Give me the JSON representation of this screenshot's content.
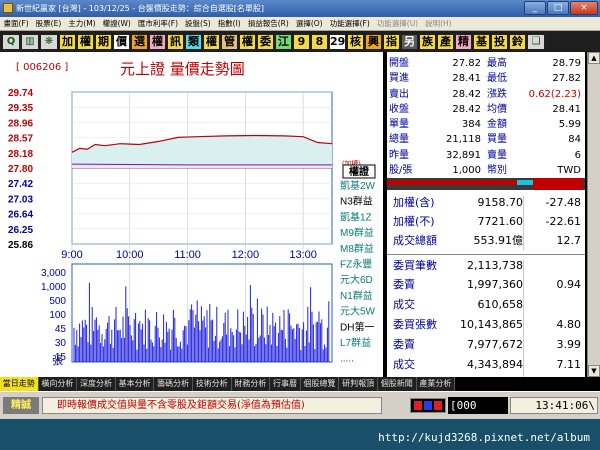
{
  "window": {
    "title": "新世紀贏家 [台灣] - 103/12/25 - 台盤價股走勢：綜合自選股[名單股]",
    "min": "_",
    "max": "□",
    "close": "×"
  },
  "menu": [
    "畫面(F)",
    "股票(E)",
    "主力(M)",
    "權證(W)",
    "匯市利率(F)",
    "設盤(S)",
    "指數(I)",
    "損益報告(R)",
    "選擇(O)",
    "功能選擇(F)",
    "功能選擇(U)",
    "說明(H)"
  ],
  "toolbar": [
    {
      "label": "Q",
      "name": "toolbar-search-icon",
      "style": "ic"
    },
    {
      "label": "▥",
      "name": "toolbar-chart-icon",
      "style": "ic"
    },
    {
      "label": "❋",
      "name": "toolbar-settings-icon",
      "style": "ic"
    },
    {
      "label": "加",
      "style": "yellow"
    },
    {
      "label": "權",
      "style": "yellow"
    },
    {
      "label": "期",
      "style": "yellow"
    },
    {
      "label": "價",
      "style": "white"
    },
    {
      "label": "選",
      "style": "orange"
    },
    {
      "label": "權",
      "style": "pink"
    },
    {
      "label": "訊",
      "style": "yellow"
    },
    {
      "label": "類",
      "style": "cyan"
    },
    {
      "label": "權",
      "style": "yellow"
    },
    {
      "label": "管",
      "style": "tan"
    },
    {
      "label": "權",
      "style": "yellow"
    },
    {
      "label": "委",
      "style": "yellow"
    },
    {
      "label": "江",
      "style": "green"
    },
    {
      "label": "9",
      "style": "yellow"
    },
    {
      "label": "8",
      "style": "yellow"
    },
    {
      "label": "29",
      "style": "white"
    },
    {
      "label": "核",
      "style": "yellow"
    },
    {
      "label": "興",
      "style": "orange"
    },
    {
      "label": "指",
      "style": "yellow"
    },
    {
      "label": "另",
      "style": "dark"
    },
    {
      "label": "族",
      "style": "yellow"
    },
    {
      "label": "產",
      "style": "yellow"
    },
    {
      "label": "精",
      "style": "pink"
    },
    {
      "label": "基",
      "style": "yellow"
    },
    {
      "label": "投",
      "style": "yellow"
    },
    {
      "label": "鈴",
      "style": "yellow"
    },
    {
      "label": "❑",
      "name": "toolbar-window-icon",
      "style": "ic"
    }
  ],
  "chart": {
    "stock_code": "[ 006206 ]",
    "title": "元上證  量價走勢圖",
    "add_weight": "(加權)",
    "warrant_header": "權證",
    "warrants": [
      "凱基2W",
      "N3群益",
      "凱基1Z",
      "M9群益",
      "M8群益",
      "FZ永豐",
      "元大6D",
      "N1群益",
      "元大5W",
      "DH第一",
      "L7群益",
      "....."
    ]
  },
  "chart_data": {
    "type": "line",
    "price_ticks": [
      "29.74",
      "29.35",
      "28.96",
      "28.57",
      "28.18",
      "27.80",
      "27.42",
      "27.03",
      "26.64",
      "26.25",
      "25.86"
    ],
    "volume_ticks": [
      "3,000",
      "1,000",
      "500",
      "100",
      "45",
      "30",
      "15"
    ],
    "volume_unit": "張",
    "x_ticks": [
      "9:00",
      "10:00",
      "11:00",
      "12:00",
      "13:00"
    ],
    "reference_price": 27.8,
    "ylim": [
      25.86,
      29.74
    ],
    "price": [
      {
        "t": 0,
        "v": 28.2
      },
      {
        "t": 8,
        "v": 28.3
      },
      {
        "t": 16,
        "v": 28.28
      },
      {
        "t": 24,
        "v": 28.4
      },
      {
        "t": 34,
        "v": 28.37
      },
      {
        "t": 50,
        "v": 28.42
      },
      {
        "t": 70,
        "v": 28.4
      },
      {
        "t": 90,
        "v": 28.48
      },
      {
        "t": 110,
        "v": 28.58
      },
      {
        "t": 130,
        "v": 28.6
      },
      {
        "t": 160,
        "v": 28.62
      },
      {
        "t": 190,
        "v": 28.63
      },
      {
        "t": 220,
        "v": 28.62
      },
      {
        "t": 240,
        "v": 28.6
      },
      {
        "t": 255,
        "v": 28.45
      },
      {
        "t": 270,
        "v": 28.42
      }
    ],
    "avg_price": [
      {
        "t": 0,
        "v": 27.9
      },
      {
        "t": 60,
        "v": 27.89
      },
      {
        "t": 120,
        "v": 27.88
      },
      {
        "t": 180,
        "v": 27.88
      },
      {
        "t": 270,
        "v": 27.88
      }
    ]
  },
  "quote": {
    "left": [
      {
        "label": "開盤",
        "value": "27.82"
      },
      {
        "label": "買進",
        "value": "28.41"
      },
      {
        "label": "賣出",
        "value": "28.42"
      },
      {
        "label": "收盤",
        "value": "28.42"
      },
      {
        "label": "單量",
        "value": "384"
      },
      {
        "label": "總量",
        "value": "21,118"
      },
      {
        "label": "昨量",
        "value": "32,891"
      },
      {
        "label": "股/張",
        "value": "1,000"
      }
    ],
    "right": [
      {
        "label": "最高",
        "value": "28.79"
      },
      {
        "label": "最低",
        "value": "27.82"
      },
      {
        "label": "漲跌",
        "value": "0.62(2.23)"
      },
      {
        "label": "均價",
        "value": "28.41"
      },
      {
        "label": "金額",
        "value": "5.99"
      },
      {
        "label": "買量",
        "value": "84"
      },
      {
        "label": "賣量",
        "value": "6"
      },
      {
        "label": "幣別",
        "value": "TWD"
      }
    ]
  },
  "stats": {
    "indices": [
      {
        "label": "加權(含)",
        "value": "9158.70",
        "change": "-27.48"
      },
      {
        "label": "加權(不)",
        "value": "7721.60",
        "change": "-22.61"
      },
      {
        "label": "成交總額",
        "value": "553.91億",
        "change": "12.7"
      }
    ],
    "orders": [
      {
        "label": "委買筆數",
        "value": "2,113,738",
        "change": ""
      },
      {
        "label": "委賣",
        "value": "1,997,360",
        "change": "0.94"
      },
      {
        "label": "成交",
        "value": "610,658",
        "change": ""
      },
      {
        "label": "委買張數",
        "value": "10,143,865",
        "change": "4.80"
      },
      {
        "label": "委賣",
        "value": "7,977,672",
        "change": "3.99"
      },
      {
        "label": "成交",
        "value": "4,343,894",
        "change": "7.11"
      }
    ]
  },
  "tabs": [
    "當日走勢",
    "橫向分析",
    "深度分析",
    "基本分析",
    "籌碼分析",
    "技術分析",
    "財務分析",
    "行事曆",
    "個股總覽",
    "研判報頂",
    "個股新聞",
    "產業分析"
  ],
  "status": {
    "brand": "精誠",
    "message": "即時報價成交值與量不含零股及鉅額交易(淨值為預估值)",
    "code": "[000",
    "time": "13:41:06\\"
  },
  "watermark": "http://kujd3268.pixnet.net/album",
  "colors": {
    "up": "#c00000",
    "area": "#d8f0f0",
    "avg": "#a000c0",
    "volume": "#2020e0",
    "label": "#0000a0"
  }
}
